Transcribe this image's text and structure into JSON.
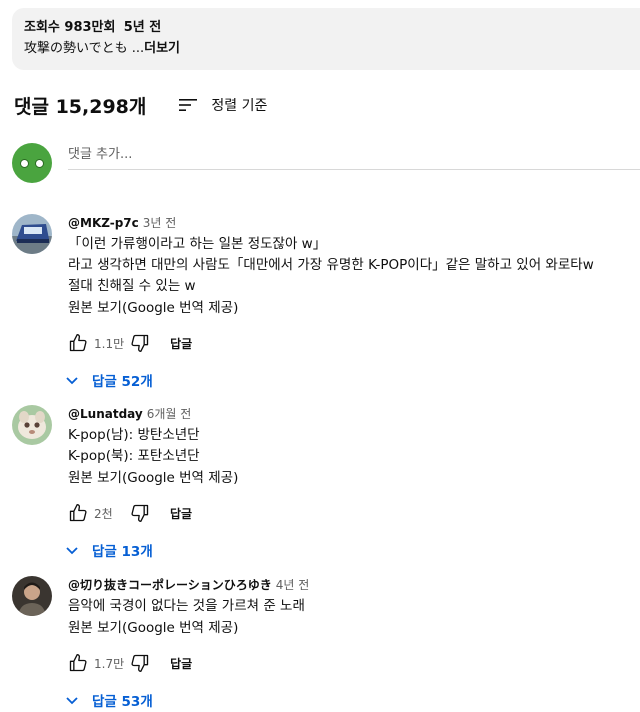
{
  "description": {
    "views": "조회수 983만회",
    "age": "5년 전",
    "text": "攻撃の勢いでとも ...",
    "more": "더보기"
  },
  "comments_header": {
    "count": "댓글 15,298개",
    "sort_label": "정렬 기준"
  },
  "add_comment": {
    "placeholder": "댓글 추가..."
  },
  "comments": [
    {
      "author": "@MKZ-p7c",
      "time": "3년 전",
      "lines": [
        "「이런 가류행이라고 하는 일본 정도잖아 w」",
        "라고 생각하면 대만의 사람도「대만에서 가장 유명한 K-POP이다」같은 말하고 있어 와로타w",
        "절대 친해질 수 있는 w"
      ],
      "translate": "원본 보기(Google 번역 제공)",
      "likes": "1.1만",
      "reply": "답글",
      "replies": "답글 52개"
    },
    {
      "author": "@Lunatday",
      "time": "6개월 전",
      "lines": [
        "K-pop(남): 방탄소년단",
        "K-pop(북): 포탄소년단"
      ],
      "translate": "원본 보기(Google 번역 제공)",
      "likes": "2천",
      "reply": "답글",
      "replies": "답글 13개"
    },
    {
      "author": "@切り抜きコーポレーションひろゆき",
      "time": "4년 전",
      "lines": [
        "음악에 국경이 없다는 것을 가르쳐 준 노래"
      ],
      "translate": "원본 보기(Google 번역 제공)",
      "likes": "1.7만",
      "reply": "답글",
      "replies": "답글 53개"
    }
  ],
  "colors": {
    "link": "#065fd4",
    "secondary": "#606060",
    "panel": "#f2f2f2"
  }
}
